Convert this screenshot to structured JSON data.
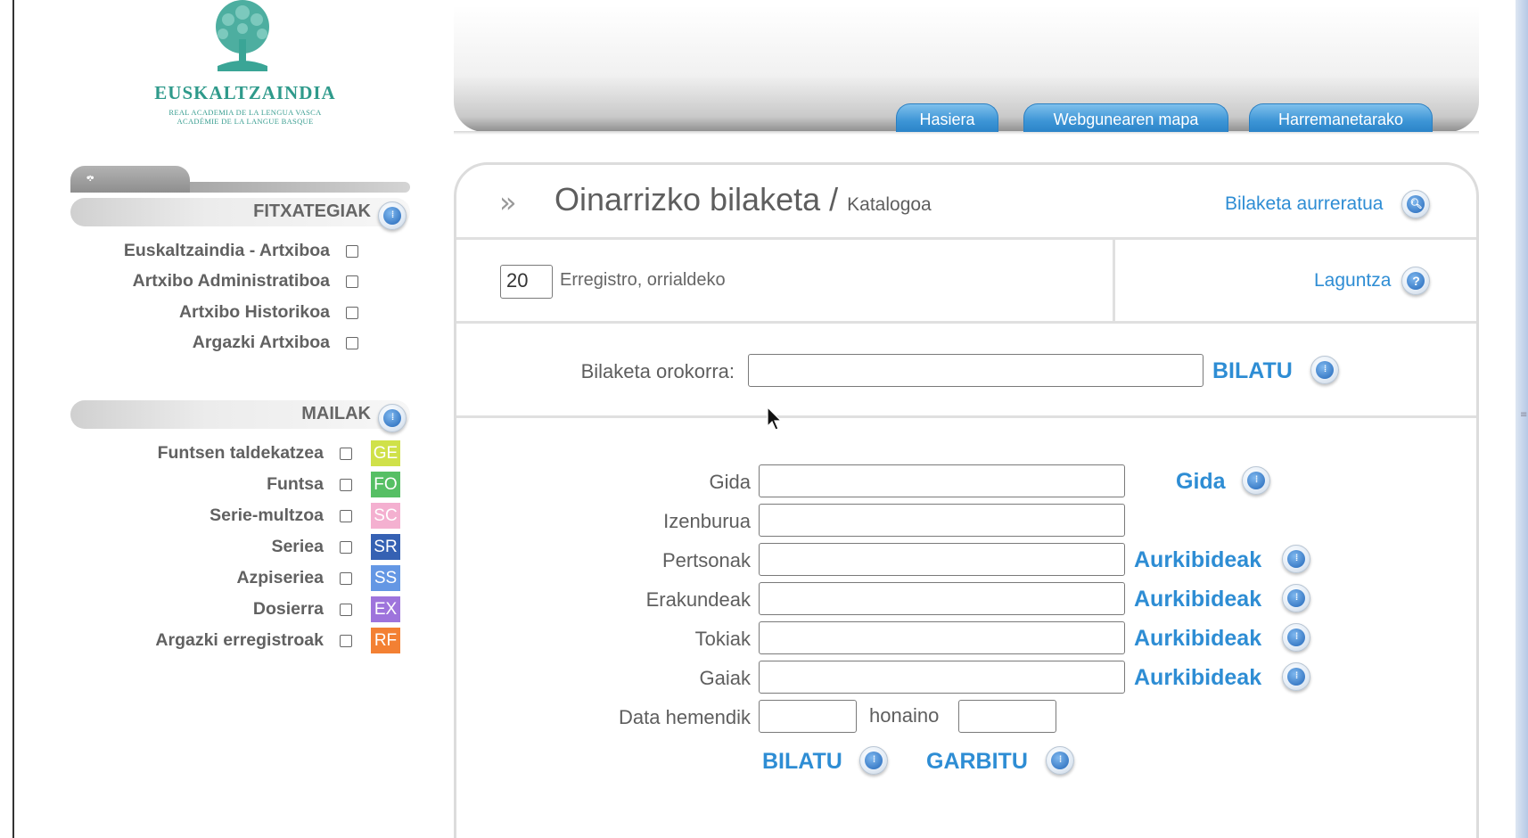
{
  "logo": {
    "name": "EUSKALTZAINDIA",
    "subtitle1": "REAL ACADEMIA DE LA LENGUA VASCA",
    "subtitle2": "ACADÉMIE DE LA LANGUE BASQUE"
  },
  "sidebar": {
    "fitxategiak": {
      "title": "FITXATEGIAK",
      "items": [
        {
          "label": "Euskaltzaindia - Artxiboa",
          "checked": false
        },
        {
          "label": "Artxibo Administratiboa",
          "checked": false
        },
        {
          "label": "Artxibo Historikoa",
          "checked": false
        },
        {
          "label": "Argazki Artxiboa",
          "checked": false
        }
      ]
    },
    "mailak": {
      "title": "MAILAK",
      "items": [
        {
          "label": "Funtsen taldekatzea",
          "badge": "GE",
          "badge_color": "#c8dc2a",
          "checked": false
        },
        {
          "label": "Funtsa",
          "badge": "FO",
          "badge_color": "#39b54a",
          "checked": false
        },
        {
          "label": "Serie-multzoa",
          "badge": "SC",
          "badge_color": "#f3a3c8",
          "checked": false
        },
        {
          "label": "Seriea",
          "badge": "SR",
          "badge_color": "#1246a6",
          "checked": false
        },
        {
          "label": "Azpiseriea",
          "badge": "SS",
          "badge_color": "#4a86e0",
          "checked": false
        },
        {
          "label": "Dosierra",
          "badge": "EX",
          "badge_color": "#8e5cd6",
          "checked": false
        },
        {
          "label": "Argazki erregistroak",
          "badge": "RF",
          "badge_color": "#f26a10",
          "checked": false
        }
      ]
    }
  },
  "nav": {
    "tabs": [
      "Hasiera",
      "Webgunearen mapa",
      "Harremanetarako"
    ]
  },
  "main": {
    "title": "Oinarrizko bilaketa /",
    "subtitle": "Katalogoa",
    "advanced_link": "Bilaketa aurreratua",
    "records_per_page": "20",
    "records_label": "Erregistro, orrialdeko",
    "help_link": "Laguntza",
    "general_search_label": "Bilaketa orokorra:",
    "general_search_value": "",
    "search_button": "BILATU",
    "fields": [
      {
        "label": "Gida",
        "value": "",
        "link": "Gida"
      },
      {
        "label": "Izenburua",
        "value": "",
        "link": ""
      },
      {
        "label": "Pertsonak",
        "value": "",
        "link": "Aurkibideak"
      },
      {
        "label": "Erakundeak",
        "value": "",
        "link": "Aurkibideak"
      },
      {
        "label": "Tokiak",
        "value": "",
        "link": "Aurkibideak"
      },
      {
        "label": "Gaiak",
        "value": "",
        "link": "Aurkibideak"
      }
    ],
    "date_from_label": "Data hemendik",
    "date_to_label": "honaino",
    "date_from_value": "",
    "date_to_value": "",
    "bilatu_button": "BILATU",
    "garbitu_button": "GARBITU"
  }
}
